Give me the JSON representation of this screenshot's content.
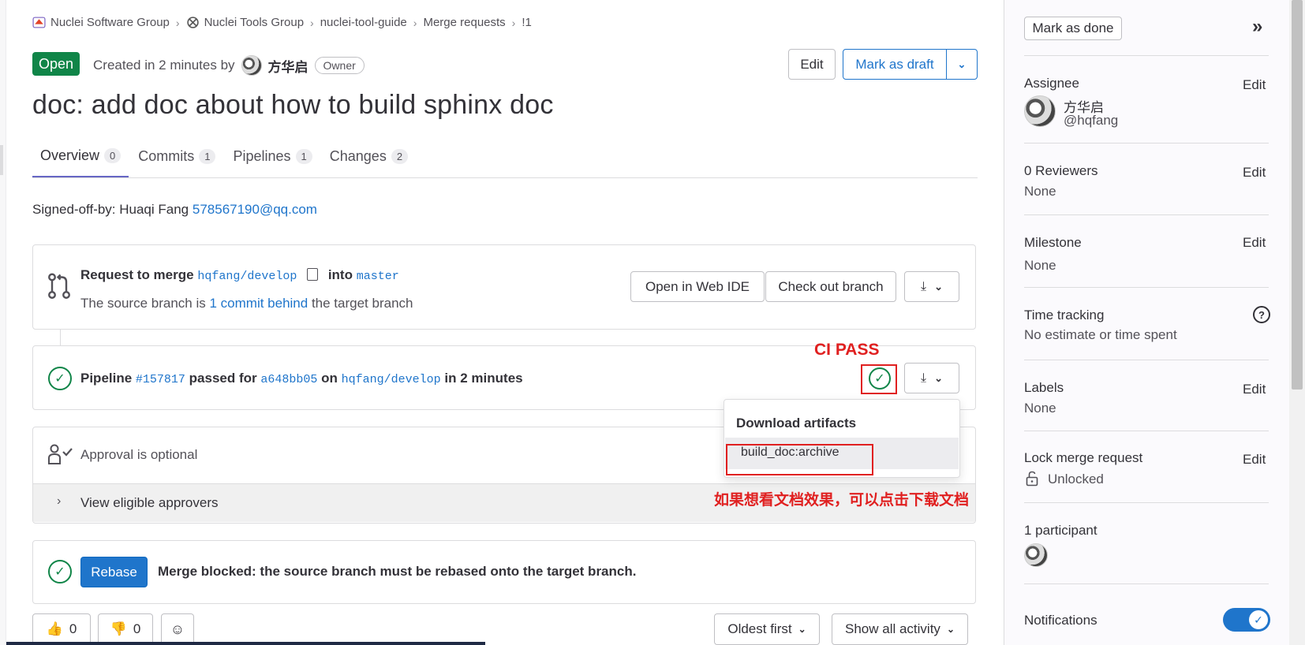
{
  "breadcrumb": {
    "items": [
      "Nuclei Software Group",
      "Nuclei Tools Group",
      "nuclei-tool-guide",
      "Merge requests",
      "!1"
    ]
  },
  "header": {
    "status": "Open",
    "created_prefix": "Created in 2 minutes by",
    "author": "方华启",
    "role": "Owner",
    "edit_label": "Edit",
    "draft_label": "Mark as draft"
  },
  "mr_title": "doc: add doc about how to build sphinx doc",
  "tabs": [
    {
      "label": "Overview",
      "count": "0"
    },
    {
      "label": "Commits",
      "count": "1"
    },
    {
      "label": "Pipelines",
      "count": "1"
    },
    {
      "label": "Changes",
      "count": "2"
    }
  ],
  "description": {
    "signed_prefix": "Signed-off-by: Huaqi Fang",
    "email": "578567190@qq.com"
  },
  "merge_request": {
    "request_label": "Request to merge",
    "source_branch": "hqfang/develop",
    "into_label": "into",
    "target_branch": "master",
    "behind_prefix": "The source branch is",
    "behind_link": "1 commit behind",
    "behind_suffix": "the target branch",
    "web_ide_label": "Open in Web IDE",
    "checkout_label": "Check out branch"
  },
  "pipeline": {
    "prefix": "Pipeline",
    "id": "#157817",
    "passed_for": "passed for",
    "commit": "a648bb05",
    "on": "on",
    "branch": "hqfang/develop",
    "duration": "in 2 minutes"
  },
  "artifacts_dropdown": {
    "header": "Download artifacts",
    "item": "build_doc:archive"
  },
  "annotations": {
    "ci_pass": "CI PASS",
    "download_hint": "如果想看文档效果，可以点击下载文档",
    "color": "#e02020"
  },
  "approval": {
    "text": "Approval is optional",
    "view_approvers": "View eligible approvers"
  },
  "rebase": {
    "button": "Rebase",
    "message": "Merge blocked: the source branch must be rebased onto the target branch."
  },
  "bottom": {
    "thumbs_up_count": "0",
    "thumbs_down_count": "0",
    "sort_label": "Oldest first",
    "filter_label": "Show all activity"
  },
  "sidebar": {
    "mark_done": "Mark as done",
    "assignee_label": "Assignee",
    "assignee_name": "方华启",
    "assignee_username": "@hqfang",
    "reviewers_label": "0 Reviewers",
    "reviewers_value": "None",
    "milestone_label": "Milestone",
    "milestone_value": "None",
    "time_tracking_label": "Time tracking",
    "time_tracking_value": "No estimate or time spent",
    "labels_label": "Labels",
    "labels_value": "None",
    "lock_label": "Lock merge request",
    "lock_value": "Unlocked",
    "participants_label": "1 participant",
    "notifications_label": "Notifications",
    "edit_label": "Edit"
  },
  "colors": {
    "open_badge": "#108548",
    "link": "#1f75cb",
    "success": "#108548",
    "tab_active": "#6666c4"
  }
}
